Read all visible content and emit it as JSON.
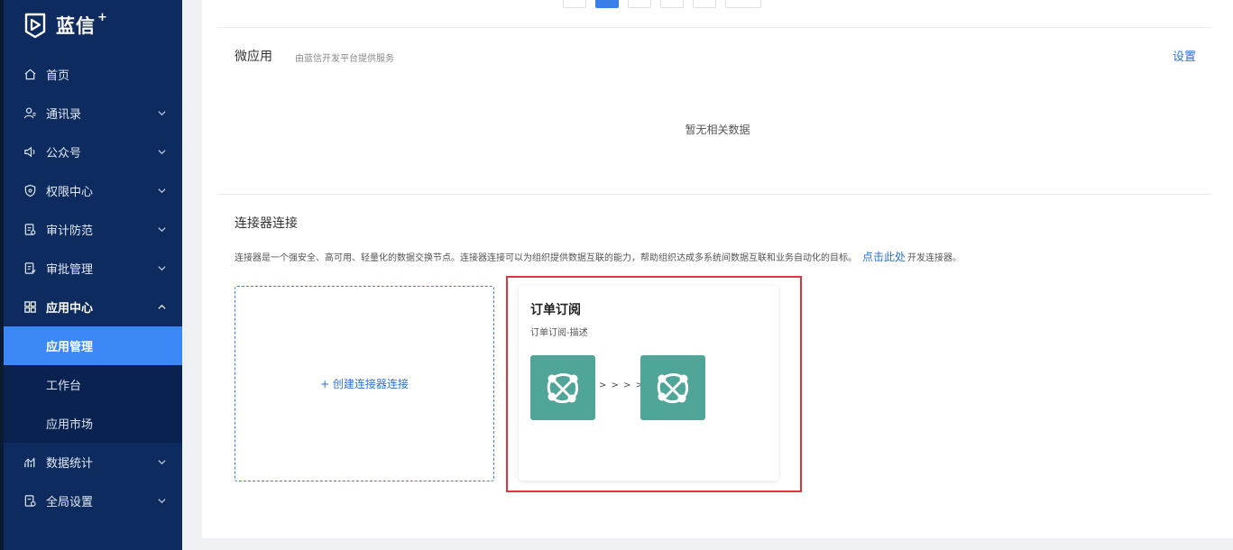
{
  "brand": {
    "name": "蓝信",
    "plus": "+"
  },
  "nav": {
    "items": [
      {
        "label": "首页",
        "icon": "home-icon",
        "has_chevron": false
      },
      {
        "label": "通讯录",
        "icon": "contacts-icon",
        "has_chevron": true
      },
      {
        "label": "公众号",
        "icon": "speaker-icon",
        "has_chevron": true
      },
      {
        "label": "权限中心",
        "icon": "shield-icon",
        "has_chevron": true
      },
      {
        "label": "审计防范",
        "icon": "audit-icon",
        "has_chevron": true
      },
      {
        "label": "审批管理",
        "icon": "approval-icon",
        "has_chevron": true
      },
      {
        "label": "应用中心",
        "icon": "grid-icon",
        "has_chevron": true,
        "expanded": true
      }
    ],
    "sub_items": [
      {
        "label": "应用管理",
        "active": true
      },
      {
        "label": "工作台",
        "active": false
      },
      {
        "label": "应用市场",
        "active": false
      }
    ],
    "bottom_items": [
      {
        "label": "数据统计",
        "icon": "chart-icon",
        "has_chevron": true
      },
      {
        "label": "全局设置",
        "icon": "settings-icon",
        "has_chevron": true
      }
    ]
  },
  "micro_apps": {
    "title": "微应用",
    "subtitle": "由蓝信开发平台提供服务",
    "settings_label": "设置",
    "empty_text": "暂无相关数据"
  },
  "connectors": {
    "title": "连接器连接",
    "description": "连接器是一个强安全、高可用、轻量化的数据交换节点。连接器连接可以为组织提供数据互联的能力，帮助组织达成多系统间数据互联和业务自动化的目标。",
    "link_text": "点击此处",
    "link_suffix": "开发连接器。",
    "create_label": "+ 创建连接器连接",
    "card": {
      "title": "订单订阅",
      "description": "订单订阅-描述",
      "arrows": "> > > > >"
    }
  },
  "colors": {
    "sidebar_bg": "#0d2b5e",
    "active_item": "#3a87f5",
    "link": "#2f6fd6",
    "app_tile": "#4fa597",
    "highlight_border": "#e0343f"
  }
}
